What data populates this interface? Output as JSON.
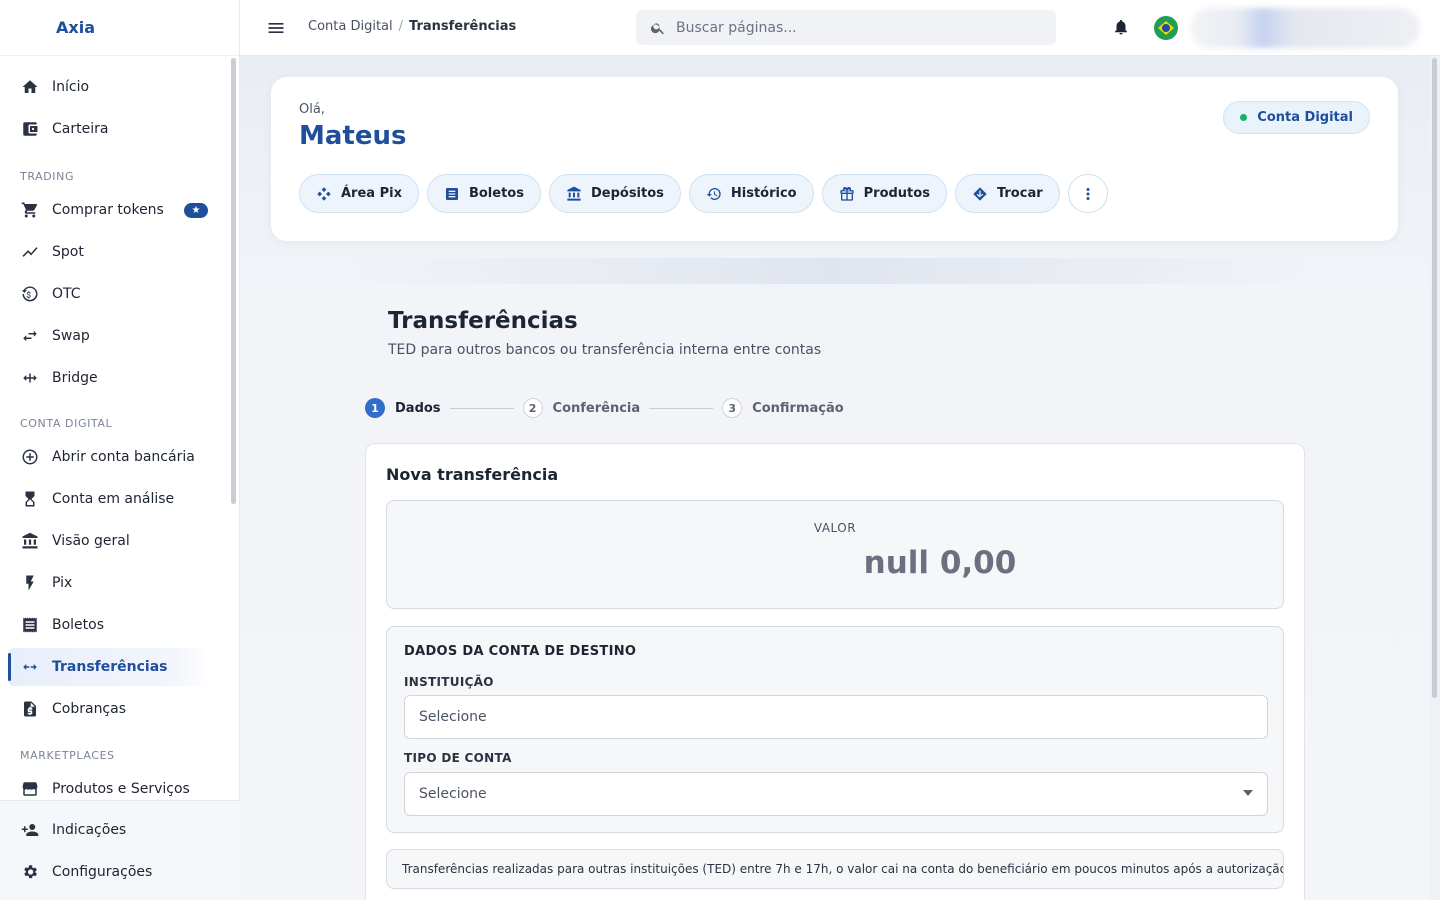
{
  "brand": {
    "name": "Axia"
  },
  "sidebar": {
    "items_top": [
      {
        "label": "Início",
        "icon": "home-icon"
      },
      {
        "label": "Carteira",
        "icon": "wallet-icon"
      }
    ],
    "trading_title": "TRADING",
    "trading": [
      {
        "label": "Comprar tokens",
        "icon": "cart-icon",
        "badge": "★"
      },
      {
        "label": "Spot",
        "icon": "trend-icon"
      },
      {
        "label": "OTC",
        "icon": "currency-exchange-icon"
      },
      {
        "label": "Swap",
        "icon": "swap-arrows-icon"
      },
      {
        "label": "Bridge",
        "icon": "bridge-arrows-icon"
      }
    ],
    "digital_title": "CONTA DIGITAL",
    "digital": [
      {
        "label": "Abrir conta bancária",
        "icon": "plus-circle-icon"
      },
      {
        "label": "Conta em análise",
        "icon": "hourglass-icon"
      },
      {
        "label": "Visão geral",
        "icon": "bank-icon"
      },
      {
        "label": "Pix",
        "icon": "bolt-icon"
      },
      {
        "label": "Boletos",
        "icon": "receipt-icon"
      },
      {
        "label": "Transferências",
        "icon": "transfer-icon",
        "active": true
      },
      {
        "label": "Cobranças",
        "icon": "invoice-dollar-icon"
      }
    ],
    "market_title": "MARKETPLACES",
    "market": [
      {
        "label": "Produtos e Serviços",
        "icon": "store-icon"
      }
    ],
    "bottom": [
      {
        "label": "Indicações",
        "icon": "person-add-icon"
      },
      {
        "label": "Configurações",
        "icon": "gear-icon"
      }
    ]
  },
  "topbar": {
    "breadcrumb": [
      "Conta Digital",
      "Transferências"
    ],
    "search_placeholder": "Buscar páginas..."
  },
  "hero": {
    "greeting": "Olá,",
    "user_name": "Mateus",
    "status": "Conta Digital",
    "actions": [
      {
        "label": "Área Pix",
        "icon": "pix-icon"
      },
      {
        "label": "Boletos",
        "icon": "receipt-icon"
      },
      {
        "label": "Depósitos",
        "icon": "bank-icon"
      },
      {
        "label": "Histórico",
        "icon": "history-icon"
      },
      {
        "label": "Produtos",
        "icon": "gift-icon"
      },
      {
        "label": "Trocar",
        "icon": "exchange-icon"
      }
    ]
  },
  "page": {
    "title": "Transferências",
    "subtitle": "TED para outros bancos ou transferência interna entre contas",
    "steps": [
      {
        "num": "1",
        "label": "Dados",
        "active": true
      },
      {
        "num": "2",
        "label": "Conferência",
        "active": false
      },
      {
        "num": "3",
        "label": "Confirmação",
        "active": false
      }
    ]
  },
  "form": {
    "card_title": "Nova transferência",
    "value_label": "VALOR",
    "value_amount": "null 0,00",
    "dest_title": "DADOS DA CONTA DE DESTINO",
    "institution_label": "INSTITUIÇÃO",
    "institution_placeholder": "Selecione",
    "account_type_label": "TIPO DE CONTA",
    "account_type_value": "Selecione",
    "notice": "Transferências realizadas para outras instituições (TED) entre 7h e 17h, o valor cai na conta do beneficiário em poucos minutos após a autorização."
  },
  "colors": {
    "accent": "#1f4e9c",
    "step_active": "#2f6ecb",
    "status_dot": "#17b26a"
  }
}
